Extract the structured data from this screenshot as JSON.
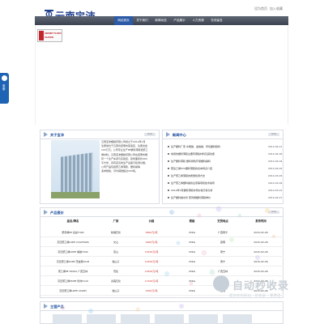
{
  "brand": {
    "name": "云南宝沛",
    "top_links": [
      "设为首页",
      "加入收藏"
    ]
  },
  "nav": [
    "网站首页",
    "关于我们",
    "新闻动态",
    "产品展示",
    "人力资源",
    "在线留言"
  ],
  "flash_labels": [
    "ADOBE FLASH",
    "PLAYER"
  ],
  "side_tab": "客服",
  "about": {
    "title": "关于宝沛",
    "more": "more",
    "lines": [
      "云南宝沛塑胶有限公司成立于2014年1月",
      "注册地位于云南省昆明市官渡区，注册资金",
      "100万元。公司专业生产PE塑料薄膜和聚乙",
      "烯材料。云南宝沛塑胶有限公司在昆明市拥",
      "有一个生产车间与实验室，建筑面积约400",
      "平方米，具有完善的生产设备与检测仪器。",
      "公司产品包括聚乙烯薄膜、塑料袋等",
      "多种规格，月均销量超过200吨。"
    ]
  },
  "news": {
    "title": "新闻中心",
    "more": "more",
    "items": [
      {
        "text": "生产塑料厂家 水果袋、金桔袋、草莓塑料膜料",
        "date": "2014-04-21"
      },
      {
        "text": "常用的塑料薄膜主要有哪些材料及其性能",
        "date": "2014-04-09"
      },
      {
        "text": "生产塑料薄膜 塑料绿色环保塑料袋料",
        "date": "2014-04-04"
      },
      {
        "text": "聚氯乙烯PVC塑料薄膜的基本特点介绍",
        "date": "2014-04-02"
      },
      {
        "text": "生产聚乙烯薄膜的质量检测方法",
        "date": "2014-03-26"
      },
      {
        "text": "生产聚乙烯塑料袋的注意事项和技术指导",
        "date": "2014-03-09"
      },
      {
        "text": "2014年3月塑料薄膜市场价格行情分析",
        "date": "2014-03-01"
      },
      {
        "text": "生产塑料袋水管 聚丙烯塑料薄膜单价",
        "date": "2014-02-27"
      }
    ]
  },
  "prices": {
    "title": "产品报价",
    "more": "more",
    "headers": [
      "品名/牌名",
      "厂家",
      "价格",
      "规格",
      "交货地点",
      "发布时间"
    ],
    "rows": [
      [
        "聚丙烯PP 拉丝T30S",
        "新疆石化",
        "9800元/吨",
        "25KG",
        "广西南宁",
        "2015-02-26"
      ],
      [
        "高压聚乙烯LDPE 2102TN26",
        "文山",
        "9900元/吨",
        "25KG",
        "昆明",
        "2015-02-26"
      ],
      [
        "高压聚乙烯LDPE 熔融7042",
        "燕山",
        "10450元/吨",
        "25KG",
        "南宁",
        "2015-02-26"
      ],
      [
        "高压聚乙烯LDPE 茂金属1018",
        "独山子",
        "10300元/吨",
        "25KG",
        "南宁",
        "2015-02-26"
      ],
      [
        "聚乙烯PE 3000A 广西玉林",
        "茂名",
        "10500元/吨",
        "25KG",
        "广西玉林",
        "2015-02-26"
      ],
      [
        "高压聚乙烯HDPE 管材5110",
        "泰森石化",
        "11300元/吨",
        "25KG",
        "昆明",
        "2015-02-26"
      ],
      [
        "高压聚乙烯LDPE 2426H",
        "独山子",
        "9500元/吨",
        "25KG",
        "昆明",
        "2015-02-26"
      ]
    ]
  },
  "products": {
    "title": "主营产品"
  },
  "watermark": {
    "big": "自动秒收录",
    "small": "提交你的网站 · 秒收录 · 零费用"
  },
  "colors": {
    "nav": "#4a5260",
    "brand": "#1f3f8e",
    "price": "#d0332c"
  }
}
